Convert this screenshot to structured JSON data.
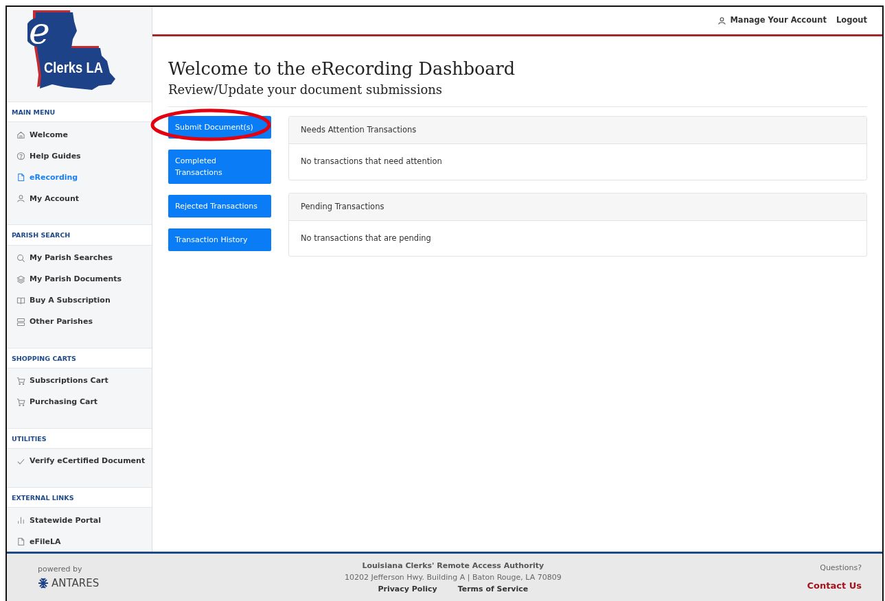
{
  "logo": {
    "mark": "e",
    "text": "Clerks LA"
  },
  "header": {
    "links": [
      {
        "label": "Manage Your Account",
        "kind": "user"
      },
      {
        "label": "Logout"
      }
    ]
  },
  "sidebar": {
    "sections": [
      {
        "title": "MAIN MENU",
        "items": [
          {
            "label": "Welcome",
            "kind": "home",
            "selected": false
          },
          {
            "label": "Help Guides",
            "kind": "help",
            "selected": false
          },
          {
            "label": "eRecording",
            "kind": "file",
            "selected": true
          },
          {
            "label": "My Account",
            "kind": "user",
            "selected": false
          }
        ]
      },
      {
        "title": "PARISH SEARCH",
        "items": [
          {
            "label": "My Parish Searches",
            "kind": "search",
            "selected": false
          },
          {
            "label": "My Parish Documents",
            "kind": "layers",
            "selected": false
          },
          {
            "label": "Buy A Subscription",
            "kind": "book",
            "selected": false
          },
          {
            "label": "Other Parishes",
            "kind": "server",
            "selected": false
          }
        ]
      },
      {
        "title": "SHOPPING CARTS",
        "items": [
          {
            "label": "Subscriptions Cart",
            "kind": "cart",
            "selected": false
          },
          {
            "label": "Purchasing Cart",
            "kind": "cart",
            "selected": false
          }
        ]
      },
      {
        "title": "UTILITIES",
        "items": [
          {
            "label": "Verify eCertified Document",
            "kind": "check",
            "selected": false
          }
        ]
      },
      {
        "title": "EXTERNAL LINKS",
        "items": [
          {
            "label": "Statewide Portal",
            "kind": "bars",
            "selected": false
          },
          {
            "label": "eFileLA",
            "kind": "file",
            "selected": false
          }
        ]
      }
    ]
  },
  "main": {
    "title": "Welcome to the eRecording Dashboard",
    "subtitle": "Review/Update your document submissions",
    "buttons": [
      {
        "label": "Submit Document(s)",
        "highlighted": true
      },
      {
        "label": "Completed Transactions",
        "highlighted": false
      },
      {
        "label": "Rejected Transactions",
        "highlighted": false
      },
      {
        "label": "Transaction History",
        "highlighted": false
      }
    ],
    "panels": [
      {
        "title": "Needs Attention Transactions",
        "body": "No transactions that need attention"
      },
      {
        "title": "Pending Transactions",
        "body": "No transactions that are pending"
      }
    ]
  },
  "footer": {
    "powered_by": "powered by",
    "brand": "ANTARES",
    "org": "Louisiana Clerks' Remote Access Authority",
    "address": "10202 Jefferson Hwy. Building A | Baton Rouge, LA 70809",
    "links": [
      "Privacy Policy",
      "Terms of Service"
    ],
    "questions": "Questions?",
    "contact": "Contact Us"
  }
}
